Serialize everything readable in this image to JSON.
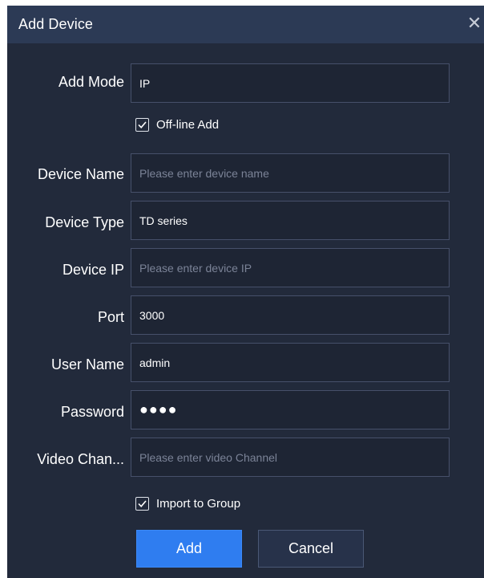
{
  "dialog": {
    "title": "Add Device",
    "close_icon": "close-icon"
  },
  "form": {
    "add_mode": {
      "label": "Add Mode",
      "value": "IP"
    },
    "offline_add": {
      "label": "Off-line Add",
      "checked": true
    },
    "device_name": {
      "label": "Device Name",
      "value": "",
      "placeholder": "Please enter device name"
    },
    "device_type": {
      "label": "Device Type",
      "value": "TD series"
    },
    "device_ip": {
      "label": "Device IP",
      "value": "",
      "placeholder": "Please enter device IP"
    },
    "port": {
      "label": "Port",
      "value": "3000"
    },
    "user_name": {
      "label": "User Name",
      "value": "admin"
    },
    "password": {
      "label": "Password",
      "value": "●●●●"
    },
    "video_channel": {
      "label": "Video Chan...",
      "value": "",
      "placeholder": "Please enter video Channel"
    },
    "import_to_group": {
      "label": "Import to Group",
      "checked": true
    }
  },
  "buttons": {
    "add": "Add",
    "cancel": "Cancel"
  },
  "colors": {
    "title_bar": "#2c3a55",
    "body": "#222a3b",
    "field_border": "#46506a",
    "primary": "#2f7df0"
  }
}
